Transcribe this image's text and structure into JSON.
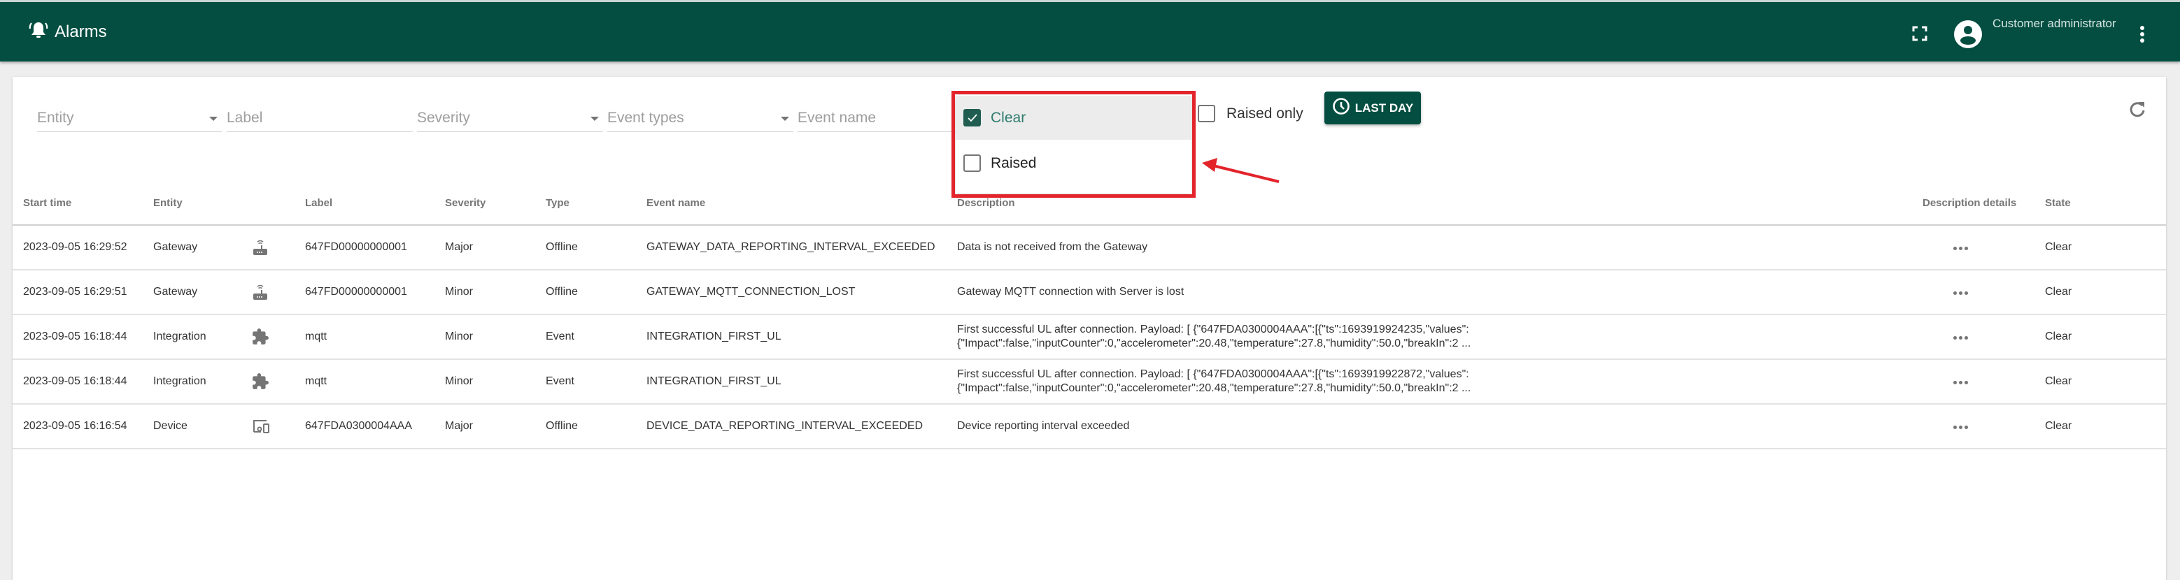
{
  "header": {
    "title": "Alarms",
    "title_icon": "bell-ring-icon",
    "fullscreen_icon": "fullscreen-icon",
    "avatar_icon": "account-circle-icon",
    "user_role": "Customer administrator",
    "menu_icon": "more-vert-icon",
    "bg_color": "#034e41"
  },
  "filters": {
    "entity_placeholder": "Entity",
    "label_placeholder": "Label",
    "severity_placeholder": "Severity",
    "event_types_placeholder": "Event types",
    "event_name_placeholder": "Event name",
    "raised_only_label": "Raised only",
    "raised_only_checked": false,
    "time_button_label": "LAST DAY",
    "time_button_icon": "clock-icon",
    "refresh_icon": "refresh-icon"
  },
  "state_dropdown": {
    "options": [
      {
        "label": "Clear",
        "checked": true
      },
      {
        "label": "Raised",
        "checked": false
      }
    ],
    "highlight_color": "#e3242b"
  },
  "table": {
    "columns": [
      "Start time",
      "Entity",
      "",
      "Label",
      "Severity",
      "Type",
      "Event name",
      "Description",
      "Description details",
      "State"
    ],
    "rows": [
      {
        "start_time": "2023-09-05 16:29:52",
        "entity": "Gateway",
        "icon": "router-icon",
        "label": "647FD00000000001",
        "severity": "Major",
        "type": "Offline",
        "event_name": "GATEWAY_DATA_REPORTING_INTERVAL_EXCEEDED",
        "description": "Data is not received from the Gateway",
        "state": "Clear"
      },
      {
        "start_time": "2023-09-05 16:29:51",
        "entity": "Gateway",
        "icon": "router-icon",
        "label": "647FD00000000001",
        "severity": "Minor",
        "type": "Offline",
        "event_name": "GATEWAY_MQTT_CONNECTION_LOST",
        "description": "Gateway MQTT connection with Server is lost",
        "state": "Clear"
      },
      {
        "start_time": "2023-09-05 16:18:44",
        "entity": "Integration",
        "icon": "puzzle-icon",
        "label": "mqtt",
        "severity": "Minor",
        "type": "Event",
        "event_name": "INTEGRATION_FIRST_UL",
        "description": "First successful UL after connection. Payload: [ {\"647FDA0300004AAA\":[{\"ts\":1693919924235,\"values\":{\"Impact\":false,\"inputCounter\":0,\"accelerometer\":20.48,\"temperature\":27.8,\"humidity\":50.0,\"breakIn\":2 ...",
        "description_line1": "First successful UL after connection. Payload: [ {\"647FDA0300004AAA\":[{\"ts\":1693919924235,\"values\":",
        "description_line2": "{\"Impact\":false,\"inputCounter\":0,\"accelerometer\":20.48,\"temperature\":27.8,\"humidity\":50.0,\"breakIn\":2 ...",
        "state": "Clear"
      },
      {
        "start_time": "2023-09-05 16:18:44",
        "entity": "Integration",
        "icon": "puzzle-icon",
        "label": "mqtt",
        "severity": "Minor",
        "type": "Event",
        "event_name": "INTEGRATION_FIRST_UL",
        "description": "First successful UL after connection. Payload: [ {\"647FDA0300004AAA\":[{\"ts\":1693919922872,\"values\":{\"Impact\":false,\"inputCounter\":0,\"accelerometer\":20.48,\"temperature\":27.8,\"humidity\":50.0,\"breakIn\":2 ...",
        "description_line1": "First successful UL after connection. Payload: [ {\"647FDA0300004AAA\":[{\"ts\":1693919922872,\"values\":",
        "description_line2": "{\"Impact\":false,\"inputCounter\":0,\"accelerometer\":20.48,\"temperature\":27.8,\"humidity\":50.0,\"breakIn\":2 ...",
        "state": "Clear"
      },
      {
        "start_time": "2023-09-05 16:16:54",
        "entity": "Device",
        "icon": "devices-icon",
        "label": "647FDA0300004AAA",
        "severity": "Major",
        "type": "Offline",
        "event_name": "DEVICE_DATA_REPORTING_INTERVAL_EXCEEDED",
        "description": "Device reporting interval exceeded",
        "state": "Clear"
      }
    ]
  }
}
